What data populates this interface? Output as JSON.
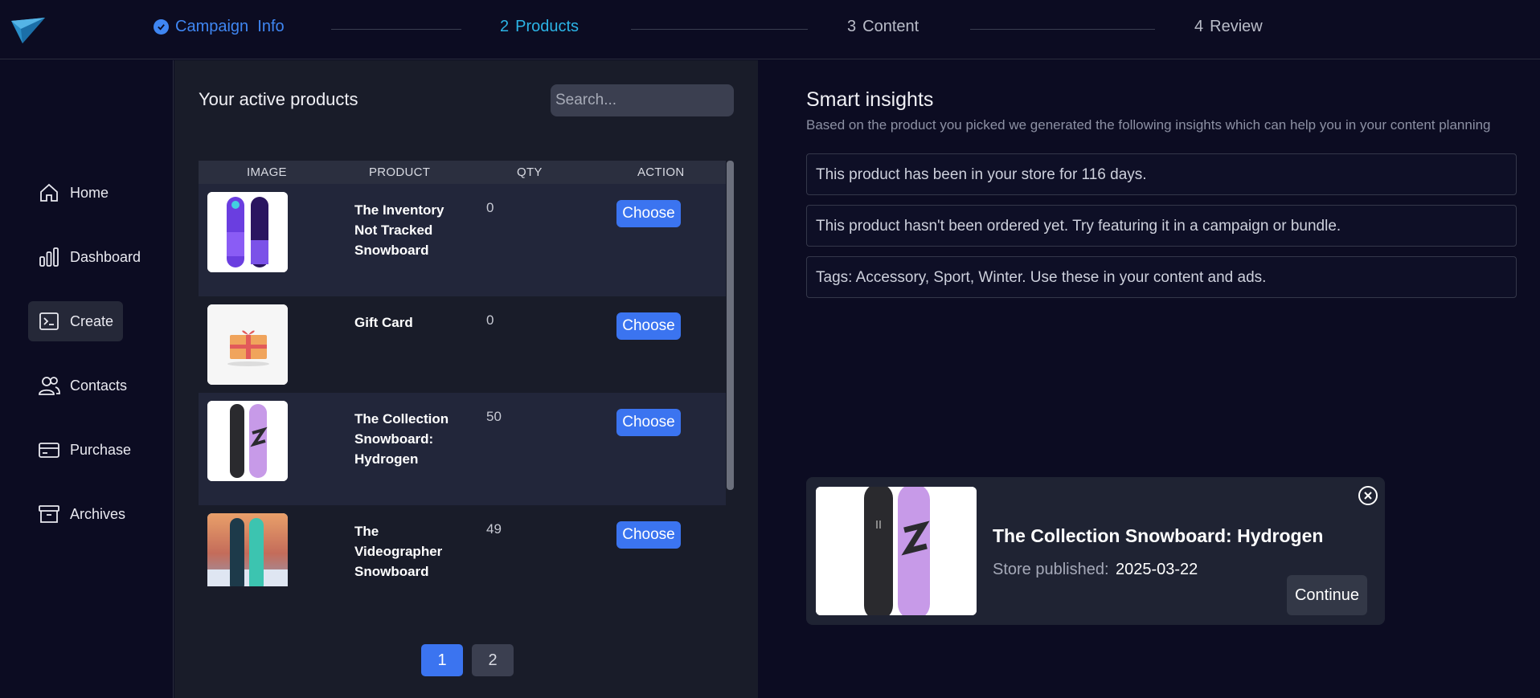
{
  "colors": {
    "background": "#0c0c22",
    "panel": "#191c29",
    "accent": "#3b74f0",
    "step_done": "#3f86f2",
    "step_active": "#2cb4e6"
  },
  "logo": {
    "icon": "paper-plane-logo"
  },
  "stepper": {
    "steps": [
      {
        "label": "Campaign  Info",
        "state": "done",
        "icon": "check-circle-icon"
      },
      {
        "number": "2",
        "label": "Products",
        "state": "active"
      },
      {
        "number": "3",
        "label": "Content",
        "state": "todo"
      },
      {
        "number": "4",
        "label": "Review",
        "state": "todo"
      }
    ]
  },
  "sidebar": {
    "items": [
      {
        "label": "Home",
        "icon": "home-icon"
      },
      {
        "label": "Dashboard",
        "icon": "bar-chart-icon"
      },
      {
        "label": "Create",
        "icon": "terminal-icon",
        "active": true
      },
      {
        "label": "Contacts",
        "icon": "users-icon"
      },
      {
        "label": "Purchase",
        "icon": "credit-card-icon"
      },
      {
        "label": "Archives",
        "icon": "archive-icon"
      }
    ]
  },
  "products": {
    "title": "Your active products",
    "search_placeholder": "Search...",
    "columns": [
      "IMAGE",
      "PRODUCT",
      "QTY",
      "ACTION"
    ],
    "rows": [
      {
        "name": "The Inventory Not Tracked Snowboard",
        "qty": "0",
        "action": "Choose",
        "image": "purple-snowboard"
      },
      {
        "name": "Gift Card",
        "qty": "0",
        "action": "Choose",
        "image": "gift-card"
      },
      {
        "name": "The Collection Snowboard: Hydrogen",
        "qty": "50",
        "action": "Choose",
        "image": "hydrogen-snowboard"
      },
      {
        "name": "The Videographer Snowboard",
        "qty": "49",
        "action": "Choose",
        "image": "videographer-snowboard"
      }
    ],
    "pagination": [
      "1",
      "2"
    ],
    "current_page": "1"
  },
  "insights": {
    "title": "Smart insights",
    "subtitle": "Based on the product you picked we generated the following insights which can help you in your content planning",
    "items": [
      "This product has been in your store for 116 days.",
      "This product hasn't been ordered yet. Try featuring it in a campaign or bundle.",
      "Tags: Accessory, Sport, Winter. Use these in your content and ads."
    ]
  },
  "selected": {
    "name": "The Collection Snowboard: Hydrogen",
    "published_label": "Store published:",
    "published_date": "2025-03-22",
    "continue_label": "Continue",
    "close_icon": "close-circle-icon"
  }
}
